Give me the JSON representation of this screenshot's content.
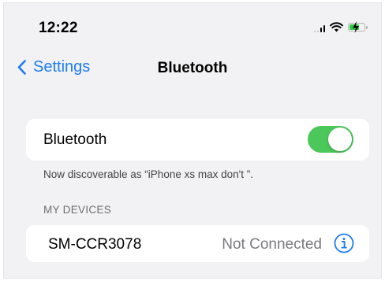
{
  "status_bar": {
    "time": "12:22"
  },
  "nav": {
    "back_label": "Settings",
    "title": "Bluetooth"
  },
  "bluetooth": {
    "label": "Bluetooth",
    "enabled": true,
    "discoverable_note": "Now discoverable as “iPhone xs max don't ”."
  },
  "my_devices": {
    "header": "MY DEVICES",
    "devices": [
      {
        "name": "SM-CCR3078",
        "status": "Not Connected"
      }
    ]
  },
  "colors": {
    "accent": "#1d7cf2",
    "toggle_on": "#4cc75a",
    "battery": "#2ecc40",
    "background": "#f2f2f4"
  },
  "icons": [
    "cellular-signal-icon",
    "wifi-icon",
    "battery-charging-icon",
    "chevron-left-icon",
    "info-icon"
  ]
}
